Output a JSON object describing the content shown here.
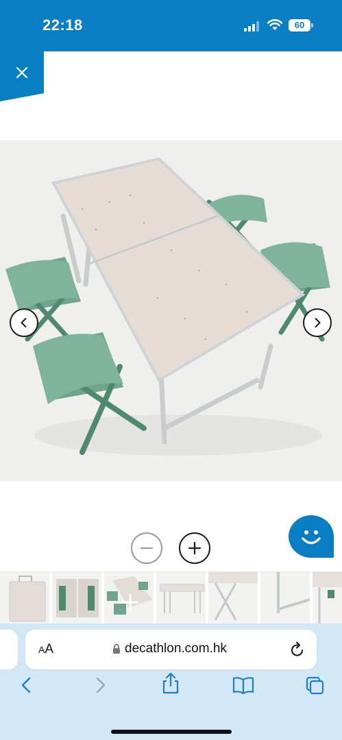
{
  "status_bar": {
    "time": "22:18",
    "battery": "60",
    "background": "#0a7ec2"
  },
  "close": {
    "icon": "close-icon"
  },
  "product": {
    "image_subject": "folding-table-with-four-green-stools",
    "prev_icon": "chevron-left-icon",
    "next_icon": "chevron-right-icon"
  },
  "zoom": {
    "out_icon": "minus-icon",
    "in_icon": "plus-icon"
  },
  "chat": {
    "icon": "smiley-chat-icon",
    "color": "#0a7ec2"
  },
  "thumbnails": [
    {
      "subject": "folded-table"
    },
    {
      "subject": "folded-table-with-stools-inside"
    },
    {
      "subject": "table-set-selected"
    },
    {
      "subject": "table-front"
    },
    {
      "subject": "table-corner-closeup"
    },
    {
      "subject": "table-leg-closeup"
    },
    {
      "subject": "table-latch-closeup"
    }
  ],
  "browser": {
    "aa_label": "AA",
    "url": "decathlon.com.hk",
    "lock_icon": "lock-icon",
    "reload_icon": "reload-icon",
    "toolbar": [
      "back-icon",
      "forward-icon",
      "share-icon",
      "bookmarks-icon",
      "tabs-icon"
    ],
    "background": "#d3e8f6"
  }
}
